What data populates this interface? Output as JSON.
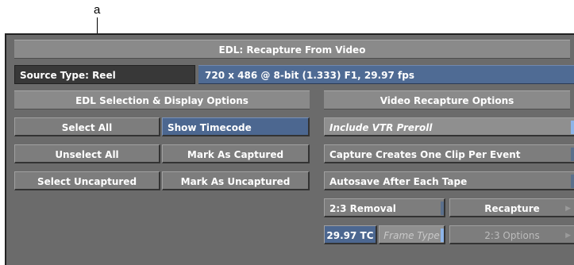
{
  "callout": "a",
  "title": "EDL: Recapture From Video",
  "source_type": "Source Type: Reel",
  "format_info": "720 x 486 @ 8-bit (1.333) F1, 29.97 fps",
  "left_header": "EDL Selection & Display Options",
  "right_header": "Video Recapture Options",
  "buttons": {
    "select_all": "Select All",
    "show_timecode": "Show Timecode",
    "unselect_all": "Unselect All",
    "mark_as_captured": "Mark As Captured",
    "select_uncaptured": "Select Uncaptured",
    "mark_as_uncaptured": "Mark As Uncaptured",
    "include_vtr_preroll": "Include VTR Preroll",
    "capture_one_clip": "Capture Creates One Clip Per Event",
    "autosave": "Autosave After Each Tape",
    "removal_23": "2:3 Removal",
    "recapture": "Recapture",
    "tc_2997": "29.97 TC",
    "frame_type": "Frame Type",
    "options_23": "2:3 Options"
  },
  "colors": {
    "panel": "#6b6b6b",
    "button": "#7d7d7d",
    "active_blue": "#4c6790",
    "indicator": "#8db4e8"
  }
}
